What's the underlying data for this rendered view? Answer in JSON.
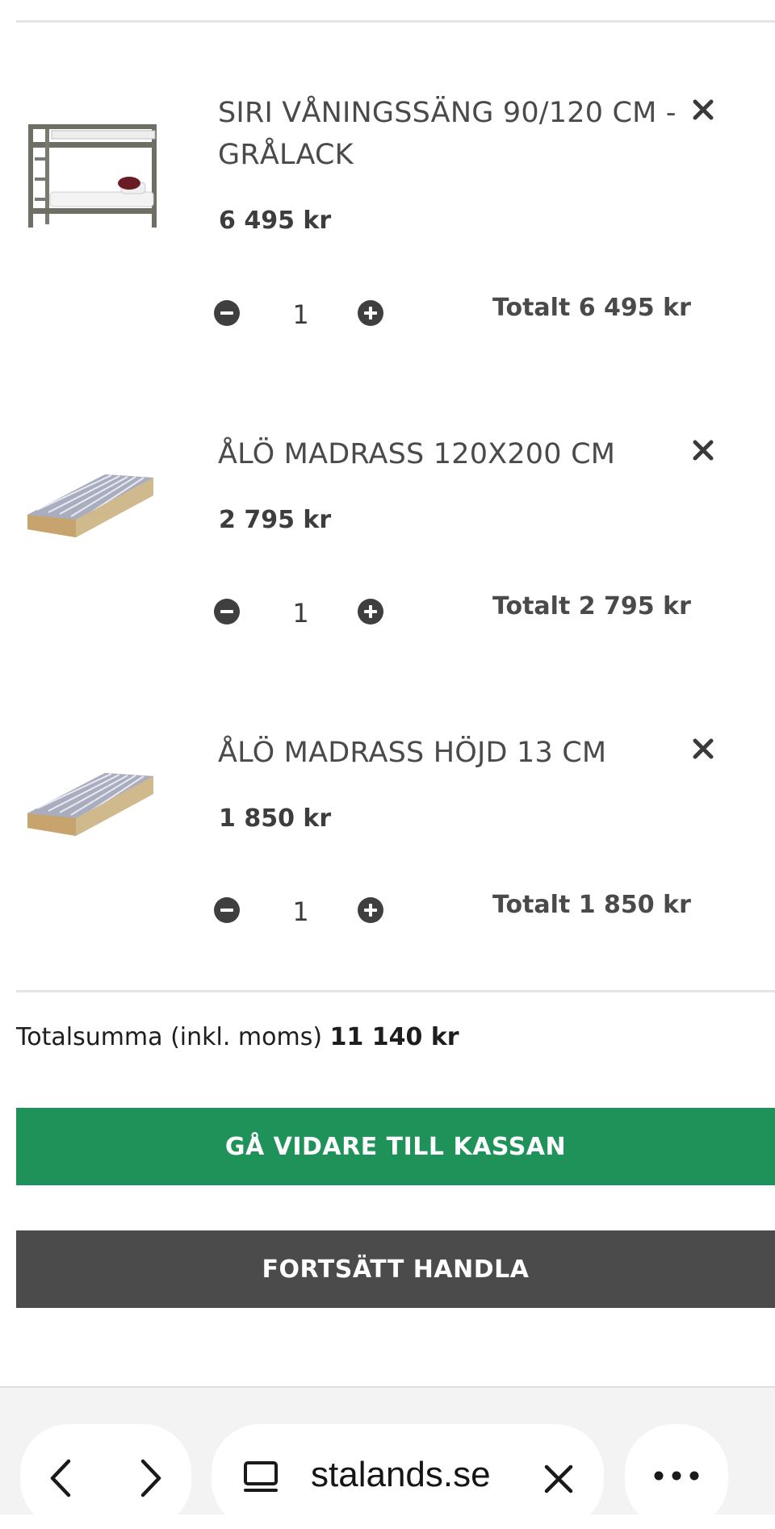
{
  "cart": {
    "items": [
      {
        "title": "SIRI VÅNINGSSÄNG 90/120 CM - GRÅLACK",
        "price": "6 495 kr",
        "quantity": "1",
        "line_total": "Totalt 6 495 kr",
        "image": "bunk-bed-image"
      },
      {
        "title": "ÅLÖ MADRASS 120X200 CM",
        "price": "2 795 kr",
        "quantity": "1",
        "line_total": "Totalt 2 795 kr",
        "image": "mattress-image"
      },
      {
        "title": "ÅLÖ MADRASS HÖJD 13 CM",
        "price": "1 850 kr",
        "quantity": "1",
        "line_total": "Totalt 1 850 kr",
        "image": "mattress-image"
      }
    ],
    "total_label": "Totalsumma (inkl. moms)",
    "total_value": "11 140 kr",
    "checkout_label": "GÅ VIDARE TILL KASSAN",
    "continue_label": "FORTSÄTT HANDLA"
  },
  "browser": {
    "url": "stalands.se",
    "icons": [
      "back-icon",
      "forward-icon",
      "tabs-icon",
      "close-icon",
      "more-icon"
    ]
  },
  "colors": {
    "checkout_green": "#1f925a",
    "continue_gray": "#4b4b4b",
    "text_dark": "#3d3d3d"
  }
}
